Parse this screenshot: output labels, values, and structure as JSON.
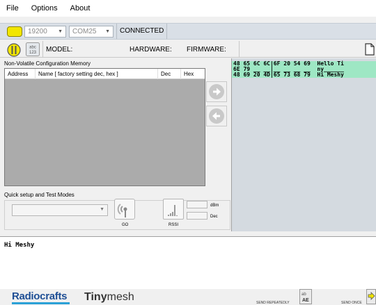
{
  "menu": {
    "items": [
      "File",
      "Options",
      "About"
    ]
  },
  "connection": {
    "baud": "19200",
    "port": "COM25",
    "status": "CONNECTED",
    "led_color": "#f2e600"
  },
  "device_info": {
    "id_icon_text": "abc 123",
    "model_label": "MODEL:",
    "hardware_label": "HARDWARE:",
    "firmware_label": "FIRMWARE:"
  },
  "nvm": {
    "title": "Non-Volatile Configuration Memory",
    "columns": [
      "Address",
      "Name  [ factory setting dec, hex ]",
      "Dec",
      "Hex"
    ]
  },
  "quick_setup": {
    "title": "Quick setup and Test Modes",
    "go_label": "GO",
    "rssi_label": "RSSI",
    "dbm_label": "dBm",
    "dec_label": "Dec"
  },
  "hex_view": {
    "lines": [
      "48 65 6C 6C|6F 20 54 69  Hello Ti",
      "6E 79 __ __|__ __ __ __  ny______",
      "48 69 20 4D|65 73 68 79  Hi Meshy"
    ]
  },
  "terminal": {
    "text": "Hi Meshy"
  },
  "footer": {
    "brand_left": "Radiocrafts",
    "brand_right_bold": "Tiny",
    "brand_right_rest": "mesh",
    "send_repeatedly": "SEND REPEATEDLY",
    "send_once": "SEND ONCE"
  },
  "colors": {
    "hex_highlight": "#9ee7c4",
    "brand_blue": "#1f4f95",
    "panel_gray": "#ababab"
  },
  "icons": {
    "status_toggle": "power-plug-icon",
    "device_id": "abc-123-icon",
    "document": "document-icon",
    "arrow_right": "arrow-right-icon",
    "arrow_left": "arrow-left-icon",
    "go": "antenna-broadcast-icon",
    "rssi": "signal-bars-icon",
    "send_repeat": "send-repeat-icon",
    "send_once": "send-once-icon"
  }
}
